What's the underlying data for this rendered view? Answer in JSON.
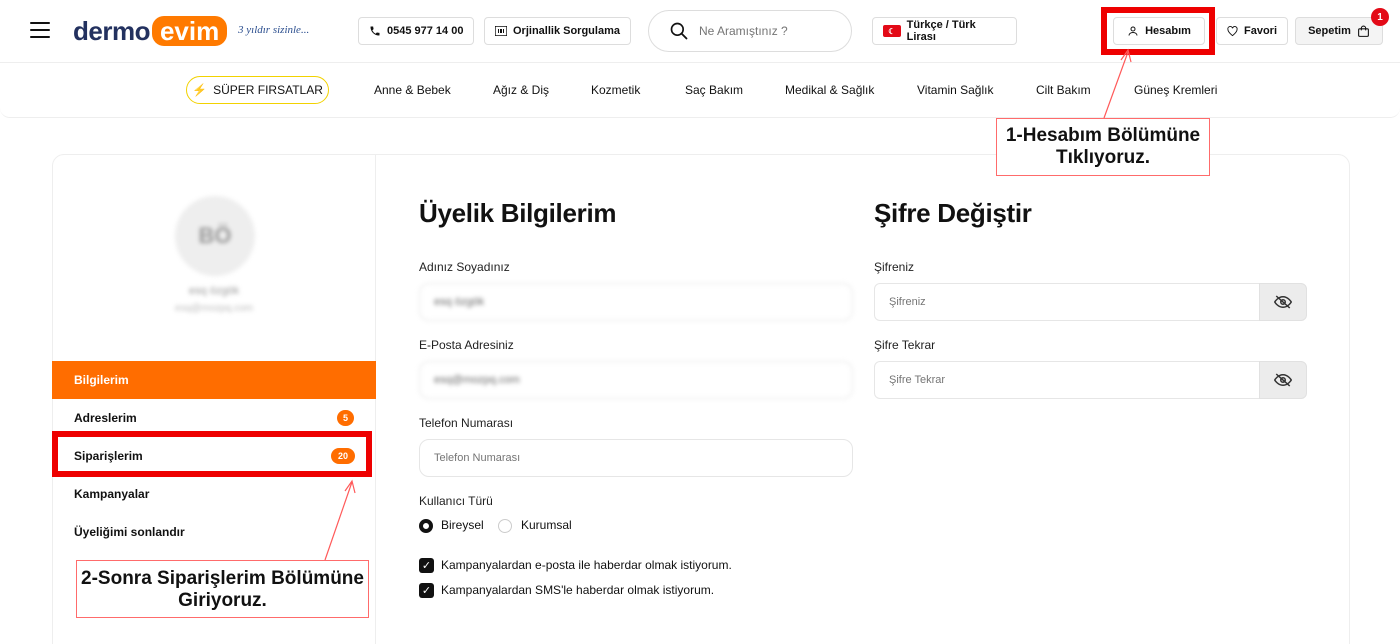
{
  "header": {
    "logo_part1": "dermo",
    "logo_part2": "evim",
    "tagline": "3 yıldır sizinle...",
    "phone": "0545 977 14 00",
    "orig_check": "Orjinallik Sorgulama",
    "search_placeholder": "Ne Aramıştınız ?",
    "language": "Türkçe / Türk Lirası",
    "account": "Hesabım",
    "favorites": "Favori",
    "cart": "Sepetim",
    "cart_count": "1"
  },
  "nav": {
    "super": "SÜPER FIRSATLAR",
    "items": [
      "Anne & Bebek",
      "Ağız & Diş",
      "Kozmetik",
      "Saç Bakım",
      "Medikal & Sağlık",
      "Vitamin Sağlık",
      "Cilt Bakım",
      "Güneş Kremleri"
    ]
  },
  "sidebar": {
    "initials": "BÖ",
    "user_name": "esq özgök",
    "user_email": "esq@mozpq.com",
    "items": [
      {
        "label": "Bilgilerim"
      },
      {
        "label": "Adreslerim",
        "count": "5"
      },
      {
        "label": "Siparişlerim",
        "count": "20"
      },
      {
        "label": "Kampanyalar"
      },
      {
        "label": "Üyeliğimi sonlandır"
      }
    ]
  },
  "profile": {
    "title": "Üyelik Bilgilerim",
    "name_label": "Adınız Soyadınız",
    "name_value": "esq özgök",
    "email_label": "E-Posta Adresiniz",
    "email_value": "esq@mozpq.com",
    "phone_label": "Telefon Numarası",
    "phone_placeholder": "Telefon Numarası",
    "user_type_label": "Kullanıcı Türü",
    "individual": "Bireysel",
    "corporate": "Kurumsal",
    "email_consent": "Kampanyalardan e-posta ile haberdar olmak istiyorum.",
    "sms_consent": "Kampanyalardan SMS'le haberdar olmak istiyorum."
  },
  "password": {
    "title": "Şifre Değiştir",
    "password_label": "Şifreniz",
    "password_placeholder": "Şifreniz",
    "repeat_label": "Şifre Tekrar",
    "repeat_placeholder": "Şifre Tekrar"
  },
  "annotations": {
    "step1": "1-Hesabım Bölümüne Tıklıyoruz.",
    "step2": "2-Sonra Siparişlerim Bölümüne Giriyoruz."
  },
  "colors": {
    "accent": "#ff6d00",
    "highlight": "#ee0000",
    "brand_navy": "#23315f"
  }
}
